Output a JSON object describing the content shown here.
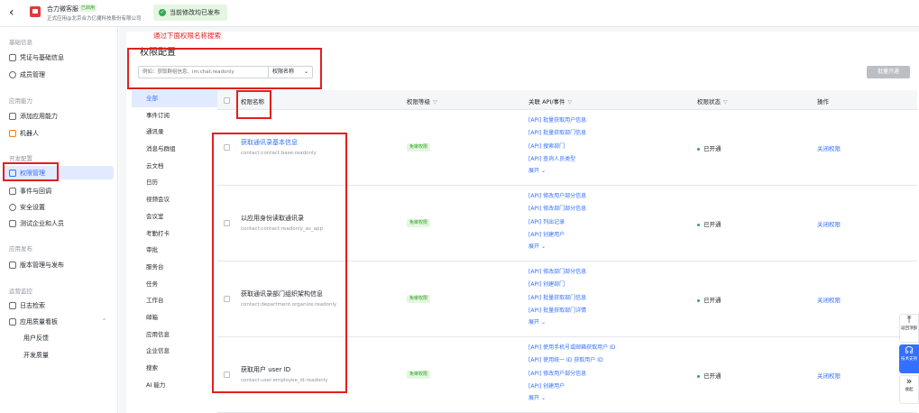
{
  "header": {
    "back_icon": "chevron-left-icon",
    "app_name": "合力微客服",
    "app_badge": "已启用",
    "company": "正式应用@北京合力亿捷科技股份有限公司",
    "status_text": "当前修改均已发布"
  },
  "sidebar": {
    "groups": [
      "基础信息",
      "应用能力",
      "开发配置",
      "应用发布",
      "运营监控"
    ],
    "items": [
      {
        "label": "凭证与基础信息",
        "icon": "card-icon"
      },
      {
        "label": "成员管理",
        "icon": "user-icon"
      },
      {
        "label": "添加应用能力",
        "icon": "grid-icon"
      },
      {
        "label": "机器人",
        "icon": "robot-icon"
      },
      {
        "label": "权限管理",
        "icon": "lock-icon"
      },
      {
        "label": "事件与回调",
        "icon": "event-icon"
      },
      {
        "label": "安全设置",
        "icon": "shield-icon"
      },
      {
        "label": "测试企业和人员",
        "icon": "test-icon"
      },
      {
        "label": "版本管理与发布",
        "icon": "version-icon"
      },
      {
        "label": "日志检索",
        "icon": "log-icon"
      },
      {
        "label": "应用质量看板",
        "icon": "chart-icon"
      },
      {
        "label": "用户反馈"
      },
      {
        "label": "开发质量"
      }
    ]
  },
  "main": {
    "annotation": "通过下面权限名称搜索",
    "title": "权限配置",
    "search_placeholder": "例如：获取群组信息、im:chat:readonly",
    "search_type": "权限名称",
    "batch_button": "批量开通",
    "categories": [
      "全部",
      "事件订阅",
      "通讯录",
      "消息与群组",
      "云文档",
      "日历",
      "视频会议",
      "会议室",
      "考勤打卡",
      "审批",
      "服务台",
      "任务",
      "工作台",
      "邮箱",
      "应用信息",
      "企业信息",
      "搜索",
      "AI 能力"
    ],
    "columns": {
      "name": "权限名称",
      "level": "权限等级",
      "api": "关联 API/事件",
      "state": "权限状态",
      "op": "操作"
    },
    "rows": [
      {
        "name": "获取通讯录基本信息",
        "code": "contact:contact.base:readonly",
        "level": "免审权限",
        "apis": [
          "[API] 批量获取用户信息",
          "[API] 批量获取部门信息",
          "[API] 搜索部门",
          "[API] 查询人员类型"
        ],
        "expand": "展开",
        "state": "已开通",
        "op": "关闭权限"
      },
      {
        "name": "以应用身份读取通讯录",
        "code": "contact:contact:readonly_as_app",
        "level": "免审权限",
        "apis": [
          "[API] 修改用户部分信息",
          "[API] 修改部门部分信息",
          "[API] 列出记录",
          "[API] 创建用户"
        ],
        "expand": "展开",
        "state": "已开通",
        "op": "关闭权限"
      },
      {
        "name": "获取通讯录部门组织架构信息",
        "code": "contact:department.organize:readonly",
        "level": "免审权限",
        "apis": [
          "[API] 修改部门部分信息",
          "[API] 创建部门",
          "[API] 批量获取部门信息",
          "[API] 批量获取部门详情"
        ],
        "expand": "展开",
        "state": "已开通",
        "op": "关闭权限"
      },
      {
        "name": "获取用户 user ID",
        "code": "contact:user.employee_id:readonly",
        "level": "免审权限",
        "apis": [
          "[API] 使用手机号或邮箱获取用户 ID",
          "[API] 使用统一 ID 获取用户 ID",
          "[API] 修改用户部分信息",
          "[API] 创建用户"
        ],
        "expand": "展开",
        "state": "已开通",
        "op": "关闭权限"
      }
    ]
  },
  "float_tools": [
    {
      "icon": "arrow-up-icon",
      "label": "返回顶部"
    },
    {
      "icon": "support-icon",
      "label": "技术支持"
    },
    {
      "icon": "collapse-icon",
      "label": "收起"
    }
  ]
}
